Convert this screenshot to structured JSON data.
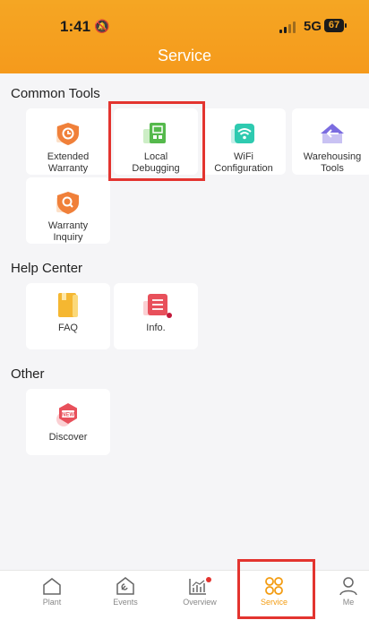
{
  "status_bar": {
    "time": "1:41",
    "network": "5G",
    "battery": "67"
  },
  "header": {
    "title": "Service"
  },
  "sections": {
    "common": {
      "title": "Common Tools",
      "items": [
        {
          "label": "Extended\nWarranty",
          "icon": "extended-warranty-icon"
        },
        {
          "label": "Local\nDebugging",
          "icon": "local-debugging-icon"
        },
        {
          "label": "WiFi\nConfiguration",
          "icon": "wifi-configuration-icon"
        },
        {
          "label": "Warehousing\nTools",
          "icon": "warehousing-tools-icon"
        },
        {
          "label": "Warranty\nInquiry",
          "icon": "warranty-inquiry-icon"
        }
      ]
    },
    "help": {
      "title": "Help Center",
      "items": [
        {
          "label": "FAQ",
          "icon": "faq-icon"
        },
        {
          "label": "Info.",
          "icon": "info-icon"
        }
      ]
    },
    "other": {
      "title": "Other",
      "items": [
        {
          "label": "Discover",
          "icon": "discover-icon",
          "badge": "NEW"
        }
      ]
    }
  },
  "tabbar": {
    "items": [
      {
        "label": "Plant"
      },
      {
        "label": "Events"
      },
      {
        "label": "Overview"
      },
      {
        "label": "Service",
        "active": true
      },
      {
        "label": "Me"
      }
    ]
  },
  "colors": {
    "accent": "#f39c12",
    "highlight": "#e3342f",
    "header": "#f5a623"
  }
}
